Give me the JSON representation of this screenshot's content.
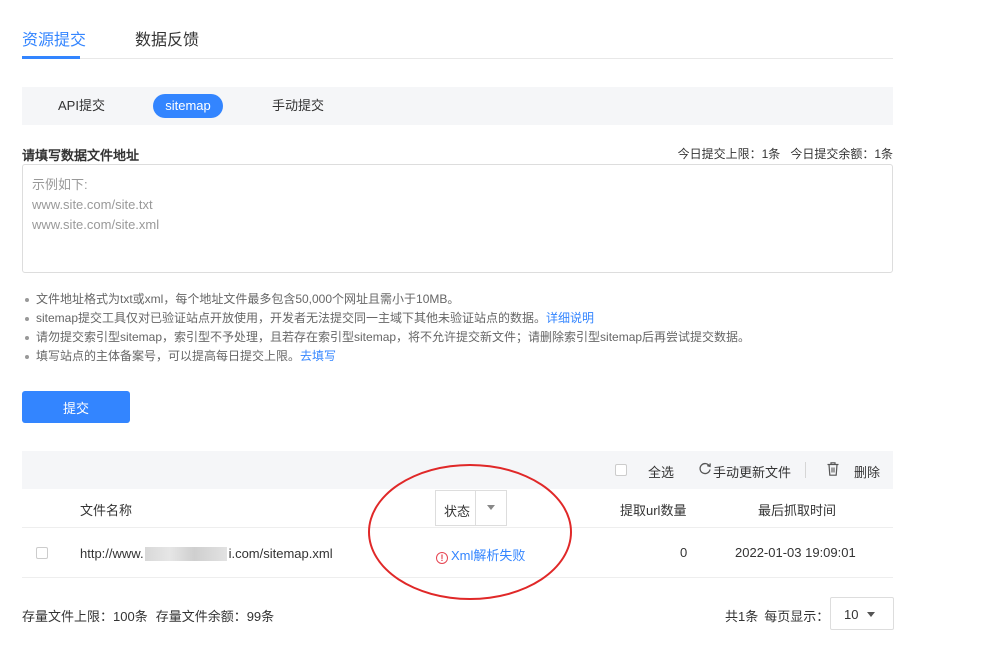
{
  "top_tabs": [
    {
      "label": "资源提交",
      "active": true
    },
    {
      "label": "数据反馈",
      "active": false
    }
  ],
  "sub_tabs": [
    {
      "label": "API提交",
      "active": false
    },
    {
      "label": "sitemap",
      "active": true
    },
    {
      "label": "手动提交",
      "active": false
    }
  ],
  "form": {
    "label": "请填写数据文件地址",
    "quota_daily_limit": "今日提交上限：1条",
    "quota_daily_remaining": "今日提交余额：1条",
    "placeholder": "示例如下:\nwww.site.com/site.txt\nwww.site.com/site.xml",
    "value": ""
  },
  "tips": {
    "tip1": "文件地址格式为txt或xml，每个地址文件最多包含50,000个网址且需小于10MB。",
    "tip2": "sitemap提交工具仅对已验证站点开放使用，开发者无法提交同一主域下其他未验证站点的数据。",
    "tip2_link": "详细说明",
    "tip3": "请勿提交索引型sitemap，索引型不予处理，且若存在索引型sitemap，将不允许提交新文件；请删除索引型sitemap后再尝试提交数据。",
    "tip4": "填写站点的主体备案号，可以提高每日提交上限。",
    "tip4_link": "去填写"
  },
  "submit_label": "提交",
  "toolbar": {
    "select_all": "全选",
    "refresh_icon": "refresh-icon",
    "refresh": "手动更新文件",
    "trash_icon": "trash-icon",
    "delete": "删除"
  },
  "table": {
    "headers": {
      "name": "文件名称",
      "status": "状态",
      "count": "提取url数量",
      "time": "最后抓取时间"
    },
    "rows": [
      {
        "url_prefix": "http://www.",
        "url_suffix": "i.com/sitemap.xml",
        "status": "Xml解析失败",
        "count": "0",
        "time": "2022-01-03 19:09:01"
      }
    ]
  },
  "footer": {
    "storage_limit": "存量文件上限：100条",
    "storage_remaining": "存量文件余额：99条",
    "total": "共1条",
    "per_page_label": "每页显示：",
    "page_size": "10"
  },
  "colors": {
    "accent": "#3385ff",
    "error": "#e64552",
    "annotation": "#e02828"
  }
}
